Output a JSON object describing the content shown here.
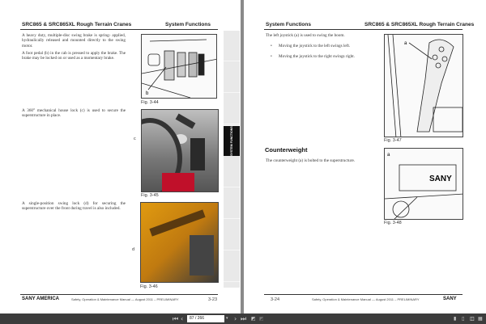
{
  "left_page": {
    "header_left": "SRC865 & SRC865XL Rough Terrain Cranes",
    "header_right": "System Functions",
    "paragraphs": [
      "A heavy duty, multiple-disc swing brake is spring- applied, hydraulically released and mounted directly to the swing motor.",
      "A foot pedal (b) in the cab is pressed to apply the brake. The brake may be locked on or used as a momentary brake.",
      "A 360° mechanical house lock (c) is used to secure the superstructure in place.",
      "A single-position swing lock (d) for securing the superstructure over the front during travel is also included."
    ],
    "figures": [
      {
        "caption": "Fig. 3-44",
        "callout": "b"
      },
      {
        "caption": "Fig. 3-45",
        "callout": "c"
      },
      {
        "caption": "Fig. 3-46",
        "callout": "d"
      }
    ],
    "side_tab_active": "SYSTEM FUNCTIONS",
    "footer_brand": "SANY AMERICA",
    "footer_text": "Safety, Operation & Maintenance Manual — August 2011 – PRELIMINARY",
    "page_number": "3-23"
  },
  "right_page": {
    "header_left": "System Functions",
    "header_right": "SRC865 & SRC865XL Rough Terrain Cranes",
    "intro": "The left joystick (a) is used to swing the boom.",
    "bullets": [
      "Moving the joystick to the left swings left.",
      "Moving the joystick to the right swings right."
    ],
    "section_title": "Counterweight",
    "section_text": "The counterweight (a) is bolted to the superstructure.",
    "figures": [
      {
        "caption": "Fig. 3-47",
        "callout": "a"
      },
      {
        "caption": "Fig. 3-48",
        "callout": "a",
        "logo": "SANY"
      }
    ],
    "footer_brand": "SANY",
    "footer_text": "Safety, Operation & Maintenance Manual — August 2011 – PRELIMINARY",
    "page_number": "3-24"
  },
  "toolbar": {
    "page_indicator": "87 / 266"
  }
}
